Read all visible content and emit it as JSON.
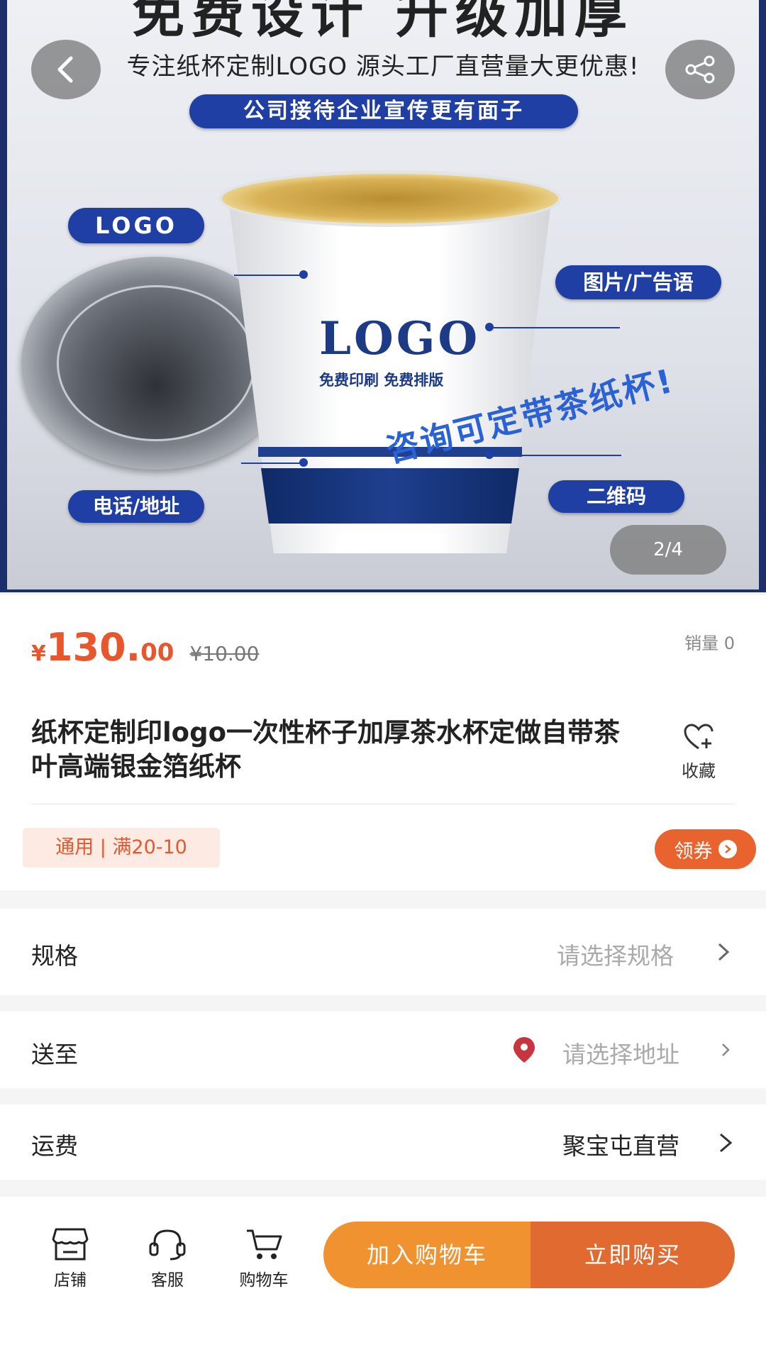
{
  "hero": {
    "headline": "免费设计 升级加厚",
    "tagline": "专注纸杯定制LOGO 源头工厂直营量大更优惠!",
    "banner": "公司接待企业宣传更有面子",
    "label_logo": "LOGO",
    "label_picture": "图片/广告语",
    "label_phone": "电话/地址",
    "label_qr": "二维码",
    "cup_logo": "LOGO",
    "cup_subtext": "免费印刷 免费排版",
    "cup_slogan": "咨询可定带茶纸杯!",
    "counter": "2/4"
  },
  "product": {
    "currency": "¥",
    "price_int": "130.",
    "price_dec": "00",
    "original_price": "¥10.00",
    "sales": "销量 0",
    "title": "纸杯定制印logo一次性杯子加厚茶水杯定做自带茶叶高端银金箔纸杯",
    "favorite_label": "收藏",
    "coupon_tag": "通用 | 满20-10",
    "coupon_button": "领券"
  },
  "options": {
    "spec_label": "规格",
    "spec_placeholder": "请选择规格",
    "ship_label": "送至",
    "ship_placeholder": "请选择地址",
    "fee_label": "运费",
    "fee_value": "聚宝屯直营"
  },
  "bottombar": {
    "store": "店铺",
    "service": "客服",
    "cart": "购物车",
    "add_to_cart": "加入购物车",
    "buy_now": "立即购买"
  },
  "colors": {
    "accent": "#e8572b",
    "cart_button": "#f0922f",
    "buy_button": "#e06a30",
    "image_blue": "#1f3fa4"
  }
}
